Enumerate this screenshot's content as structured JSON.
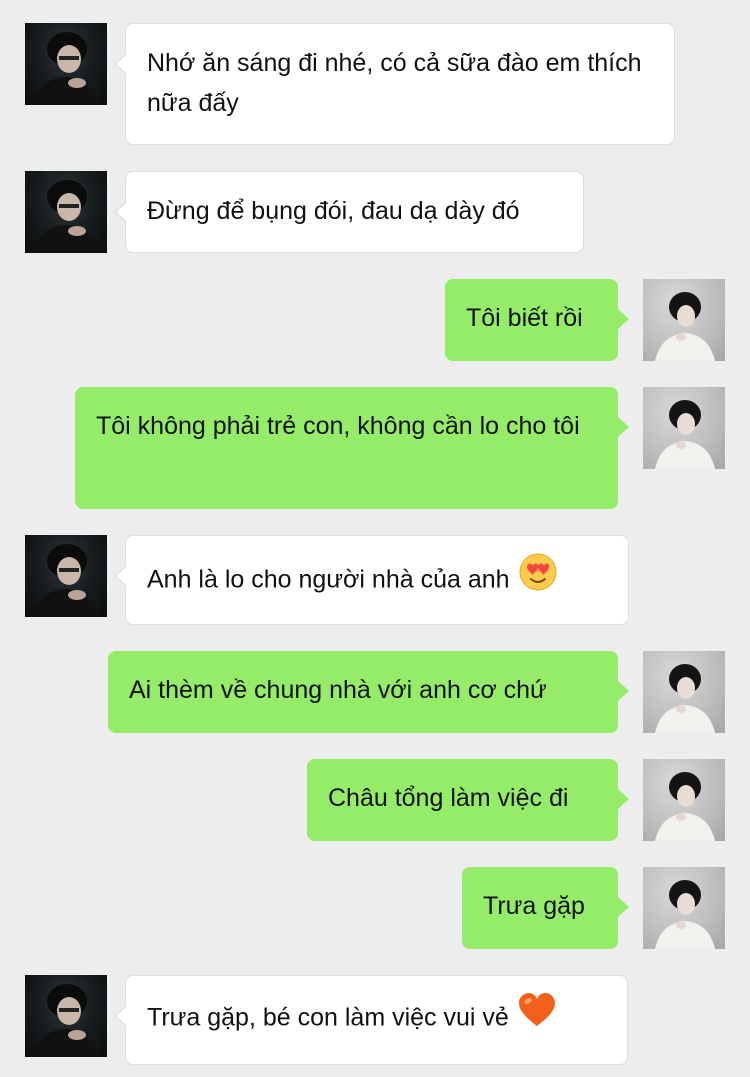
{
  "chat": {
    "messages": [
      {
        "side": "in",
        "sender": "other",
        "text": "Nhớ ăn sáng đi nhé, có cả sữa đào em thích nữa đấy"
      },
      {
        "side": "in",
        "sender": "other",
        "text": "Đừng để bụng đói, đau dạ dày đó"
      },
      {
        "side": "out",
        "sender": "me",
        "text": "Tôi biết rồi"
      },
      {
        "side": "out",
        "sender": "me",
        "text": "Tôi không phải trẻ con, không cần lo cho tôi"
      },
      {
        "side": "in",
        "sender": "other",
        "text": "Anh là lo cho người nhà của anh",
        "emoji": "heart-eyes-emoji"
      },
      {
        "side": "out",
        "sender": "me",
        "text": "Ai thèm về chung nhà với anh cơ chứ"
      },
      {
        "side": "out",
        "sender": "me",
        "text": "Châu tổng làm việc đi"
      },
      {
        "side": "out",
        "sender": "me",
        "text": "Trưa gặp"
      },
      {
        "side": "in",
        "sender": "other",
        "text": "Trưa gặp, bé con làm việc vui vẻ",
        "emoji": "heart-emoji"
      }
    ]
  },
  "colors": {
    "background": "#ededed",
    "outgoing_bubble": "#95ec69",
    "incoming_bubble": "#ffffff"
  }
}
